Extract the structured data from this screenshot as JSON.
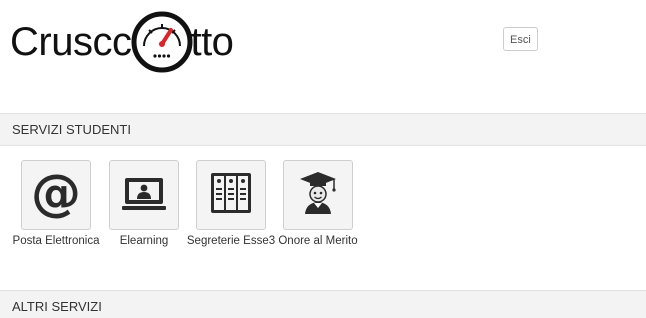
{
  "brand": {
    "logo_before": "Cruscc",
    "logo_after": "tto"
  },
  "header": {
    "logout_label": "Esci"
  },
  "sections": [
    {
      "title": "SERVIZI STUDENTI",
      "services": [
        {
          "label": "Posta Elettronica",
          "icon": "at-sign-icon"
        },
        {
          "label": "Elearning",
          "icon": "monitor-user-icon"
        },
        {
          "label": "Segreterie Esse3",
          "icon": "file-cabinet-icon"
        },
        {
          "label": "Onore al Merito",
          "icon": "graduate-icon"
        }
      ]
    },
    {
      "title": "ALTRI SERVIZI",
      "services": []
    }
  ],
  "colors": {
    "gauge_needle": "#d9262b",
    "section_bar": "#f3f3f3",
    "tile_background": "#f4f4f4"
  }
}
